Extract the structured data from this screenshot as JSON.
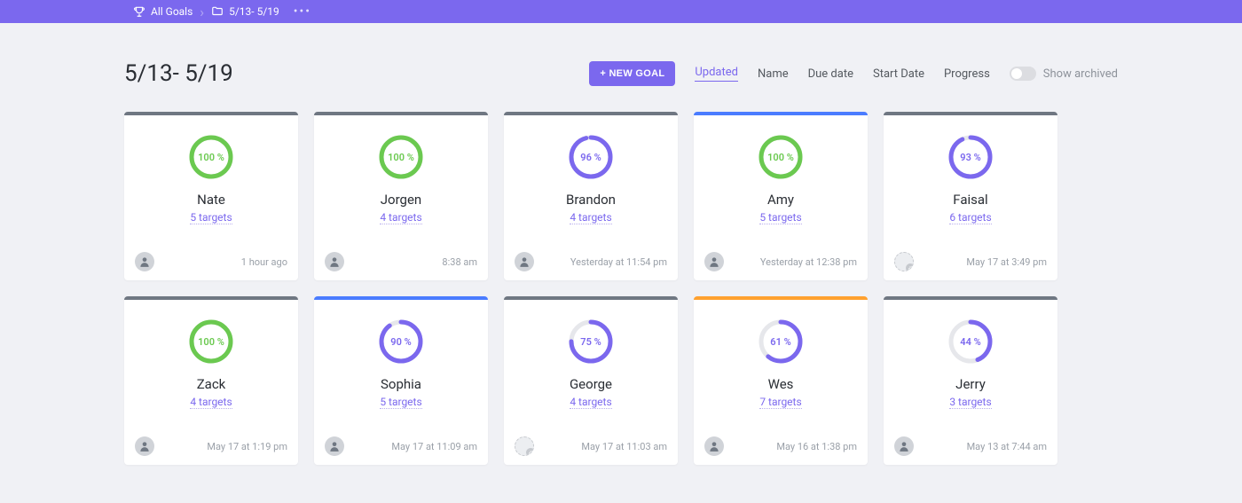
{
  "breadcrumb": {
    "root": "All Goals",
    "folder": "5/13- 5/19"
  },
  "page_title": "5/13- 5/19",
  "toolbar": {
    "new_goal": "+ NEW GOAL",
    "sort": {
      "updated": "Updated",
      "name": "Name",
      "due_date": "Due date",
      "start_date": "Start Date",
      "progress": "Progress"
    },
    "show_archived": "Show archived"
  },
  "cards": [
    {
      "name": "Nate",
      "percent": 100,
      "percent_label": "100 %",
      "targets": "5 targets",
      "timestamp": "1 hour ago",
      "ring": "green",
      "accent": "grey",
      "avatar": "person"
    },
    {
      "name": "Jorgen",
      "percent": 100,
      "percent_label": "100 %",
      "targets": "4 targets",
      "timestamp": "8:38 am",
      "ring": "green",
      "accent": "grey",
      "avatar": "person"
    },
    {
      "name": "Brandon",
      "percent": 96,
      "percent_label": "96 %",
      "targets": "4 targets",
      "timestamp": "Yesterday at 11:54 pm",
      "ring": "purple",
      "accent": "grey",
      "avatar": "person"
    },
    {
      "name": "Amy",
      "percent": 100,
      "percent_label": "100 %",
      "targets": "5 targets",
      "timestamp": "Yesterday at 12:38 pm",
      "ring": "green",
      "accent": "blue",
      "avatar": "person"
    },
    {
      "name": "Faisal",
      "percent": 93,
      "percent_label": "93 %",
      "targets": "6 targets",
      "timestamp": "May 17 at 3:49 pm",
      "ring": "purple",
      "accent": "grey",
      "avatar": "empty"
    },
    {
      "name": "Zack",
      "percent": 100,
      "percent_label": "100 %",
      "targets": "4 targets",
      "timestamp": "May 17 at 1:19 pm",
      "ring": "green",
      "accent": "grey",
      "avatar": "person"
    },
    {
      "name": "Sophia",
      "percent": 90,
      "percent_label": "90 %",
      "targets": "5 targets",
      "timestamp": "May 17 at 11:09 am",
      "ring": "purple",
      "accent": "blue",
      "avatar": "person"
    },
    {
      "name": "George",
      "percent": 75,
      "percent_label": "75 %",
      "targets": "4 targets",
      "timestamp": "May 17 at 11:03 am",
      "ring": "purple",
      "accent": "grey",
      "avatar": "empty"
    },
    {
      "name": "Wes",
      "percent": 61,
      "percent_label": "61 %",
      "targets": "7 targets",
      "timestamp": "May 16 at 1:38 pm",
      "ring": "purple",
      "accent": "orange",
      "avatar": "person"
    },
    {
      "name": "Jerry",
      "percent": 44,
      "percent_label": "44 %",
      "targets": "3 targets",
      "timestamp": "May 13 at 7:44 am",
      "ring": "purple",
      "accent": "grey",
      "avatar": "person"
    }
  ]
}
